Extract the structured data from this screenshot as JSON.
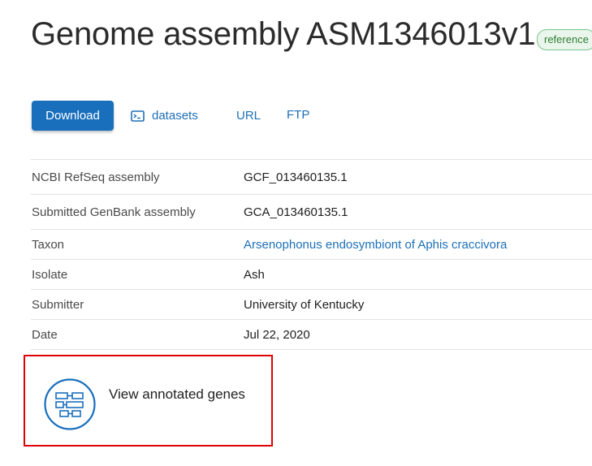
{
  "header": {
    "title": "Genome assembly ASM1346013v1",
    "badge": "reference"
  },
  "actions": {
    "download_label": "Download",
    "datasets_label": "datasets",
    "url_label": "URL",
    "ftp_label": "FTP"
  },
  "details": [
    {
      "label": "NCBI RefSeq assembly",
      "value": "GCF_013460135.1",
      "is_link": false
    },
    {
      "label": "Submitted GenBank assembly",
      "value": "GCA_013460135.1",
      "is_link": false
    },
    {
      "label": "Taxon",
      "value": "Arsenophonus endosymbiont of Aphis craccivora",
      "is_link": true
    },
    {
      "label": "Isolate",
      "value": "Ash",
      "is_link": false
    },
    {
      "label": "Submitter",
      "value": "University of Kentucky",
      "is_link": false
    },
    {
      "label": "Date",
      "value": "Jul 22, 2020",
      "is_link": false
    }
  ],
  "genes_card": {
    "label": "View annotated genes",
    "icon": "gene-structure-icon"
  },
  "colors": {
    "accent": "#1a6fbd",
    "link": "#1d6fb8",
    "badge_border": "#7cc48a",
    "badge_bg": "#eaf6ec",
    "highlight": "#e00000"
  }
}
